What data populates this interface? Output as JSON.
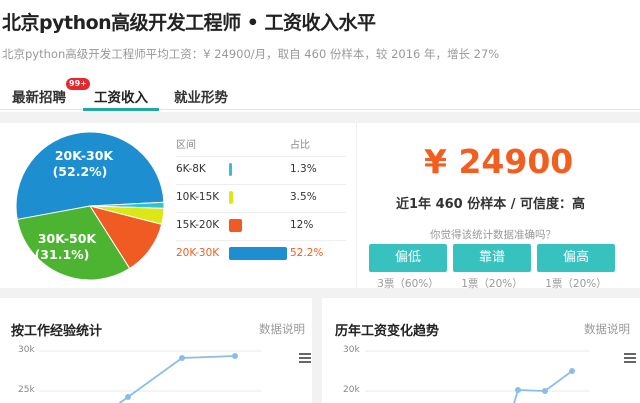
{
  "header": {
    "title": "北京python高级开发工程师 • 工资收入水平",
    "subtitle": "北京python高级开发工程师平均工资：¥ 24900/月，取自 460 份样本，较 2016 年，增长 27%"
  },
  "tabs": [
    {
      "label": "最新招聘",
      "badge": "99+"
    },
    {
      "label": "工资收入",
      "active": true
    },
    {
      "label": "就业形势"
    }
  ],
  "pie": {
    "slices": [
      {
        "range": "20K-30K",
        "percent": 52.2,
        "color": "#1d8fd0"
      },
      {
        "range": "30K-50K",
        "percent": 31.1,
        "color": "#4db432"
      },
      {
        "range": "15K-20K",
        "percent": 12,
        "color": "#f05a23"
      },
      {
        "range": "10K-15K",
        "percent": 3.5,
        "color": "#dde617"
      },
      {
        "range": "6K-8K",
        "percent": 1.3,
        "color": "#30c1d3"
      }
    ],
    "label_big_1_range": "20K-30K",
    "label_big_1_pct": "(52.2%)",
    "label_big_2_range": "30K-50K",
    "label_big_2_pct": "(31.1%)"
  },
  "table": {
    "head_range": "区间",
    "head_pct": "占比",
    "rows": [
      {
        "range": "6K-8K",
        "pct": "1.3%",
        "color": "#30c1d3",
        "share": 0.013
      },
      {
        "range": "10K-15K",
        "pct": "3.5%",
        "color": "#dde617",
        "share": 0.035
      },
      {
        "range": "15K-20K",
        "pct": "12%",
        "color": "#f05a23",
        "share": 0.12
      },
      {
        "range": "20K-30K",
        "pct": "52.2%",
        "color": "#1d8fd0",
        "share": 0.522,
        "highlight": true
      }
    ],
    "highlight_color": "#f25d20"
  },
  "summary": {
    "salary": "¥ 24900",
    "sample": "近1年 460 份样本 / 可信度：高",
    "question": "你觉得该统计数据准确吗？",
    "votes": [
      {
        "label": "偏低",
        "count": "3票（60%）"
      },
      {
        "label": "靠谱",
        "count": "1票（20%）"
      },
      {
        "label": "偏高",
        "count": "1票（20%）"
      }
    ]
  },
  "charts": [
    {
      "title": "按工作经验统计",
      "link": "数据说明",
      "yticks": [
        "30k",
        "25k"
      ]
    },
    {
      "title": "历年工资变化趋势",
      "link": "数据说明",
      "yticks": [
        "30k",
        "20k"
      ]
    }
  ],
  "colors": {
    "accent": "#37c2c0",
    "orange": "#f25d20",
    "line": "#8bbde8"
  }
}
